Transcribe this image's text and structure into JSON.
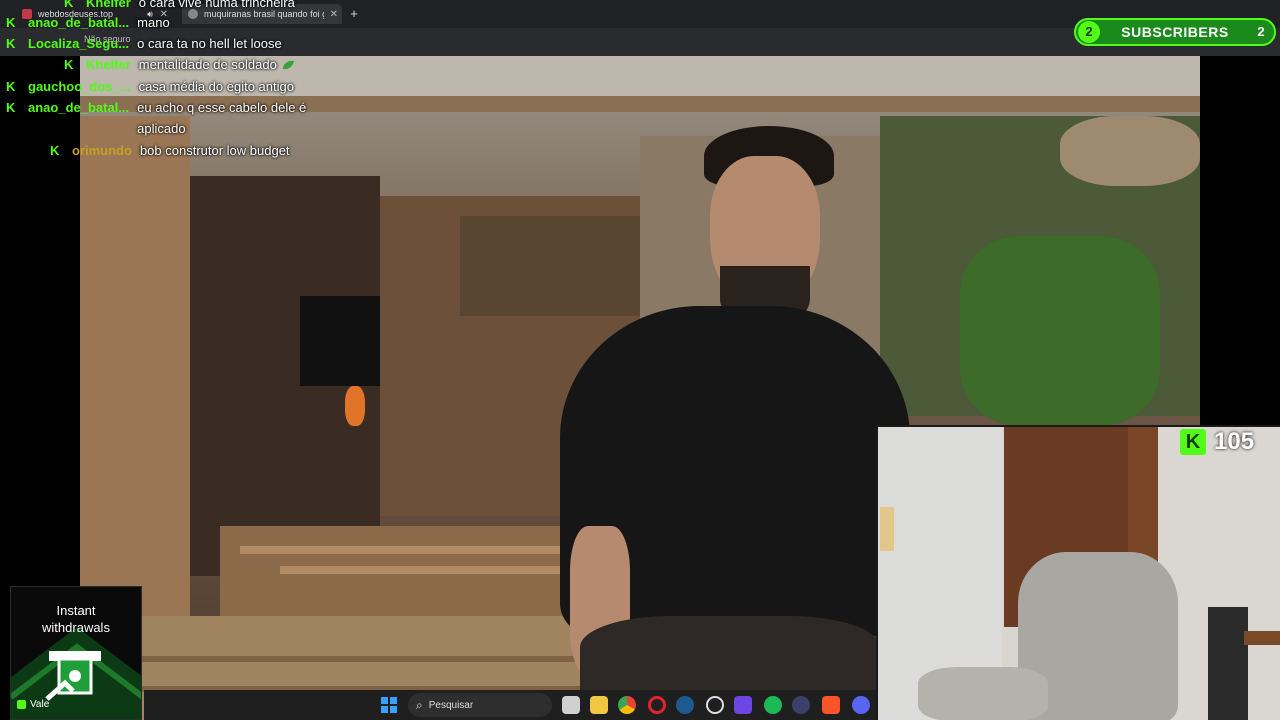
{
  "browser": {
    "tabs": [
      {
        "label": "webdosdeuses.top",
        "close": "✕"
      },
      {
        "label": "muquiranas brasil quando foi g",
        "close": "✕"
      }
    ],
    "new_tab": "+",
    "address_hint": "Não seguro"
  },
  "chat": {
    "messages": [
      {
        "user": "Khelfer",
        "text": "o cara vive numa trincheira"
      },
      {
        "user": "anao_de_batal...",
        "text": "mano"
      },
      {
        "user": "Localiza_Segu...",
        "text": "o cara ta no hell let loose"
      },
      {
        "user": "Khelfer",
        "text": "mentalidade de soldado"
      },
      {
        "user": "gauchoo_dos_...",
        "text": "casa média do egito antigo"
      },
      {
        "user": "anao_de_batal...",
        "text": "eu acho q esse cabelo dele é aplicado"
      },
      {
        "user": "orimundo",
        "text": "bob construtor low budget"
      }
    ]
  },
  "subscribers": {
    "left_count": "2",
    "label": "SUBSCRIBERS",
    "right_count": "2"
  },
  "viewers": {
    "count": "105"
  },
  "ad": {
    "line1": "Instant",
    "line2": "withdrawals",
    "footer": "Vale"
  },
  "taskbar": {
    "search_placeholder": "Pesquisar"
  },
  "colors": {
    "kick_green": "#53fc18",
    "subs_bg": "#1a8a1a"
  }
}
